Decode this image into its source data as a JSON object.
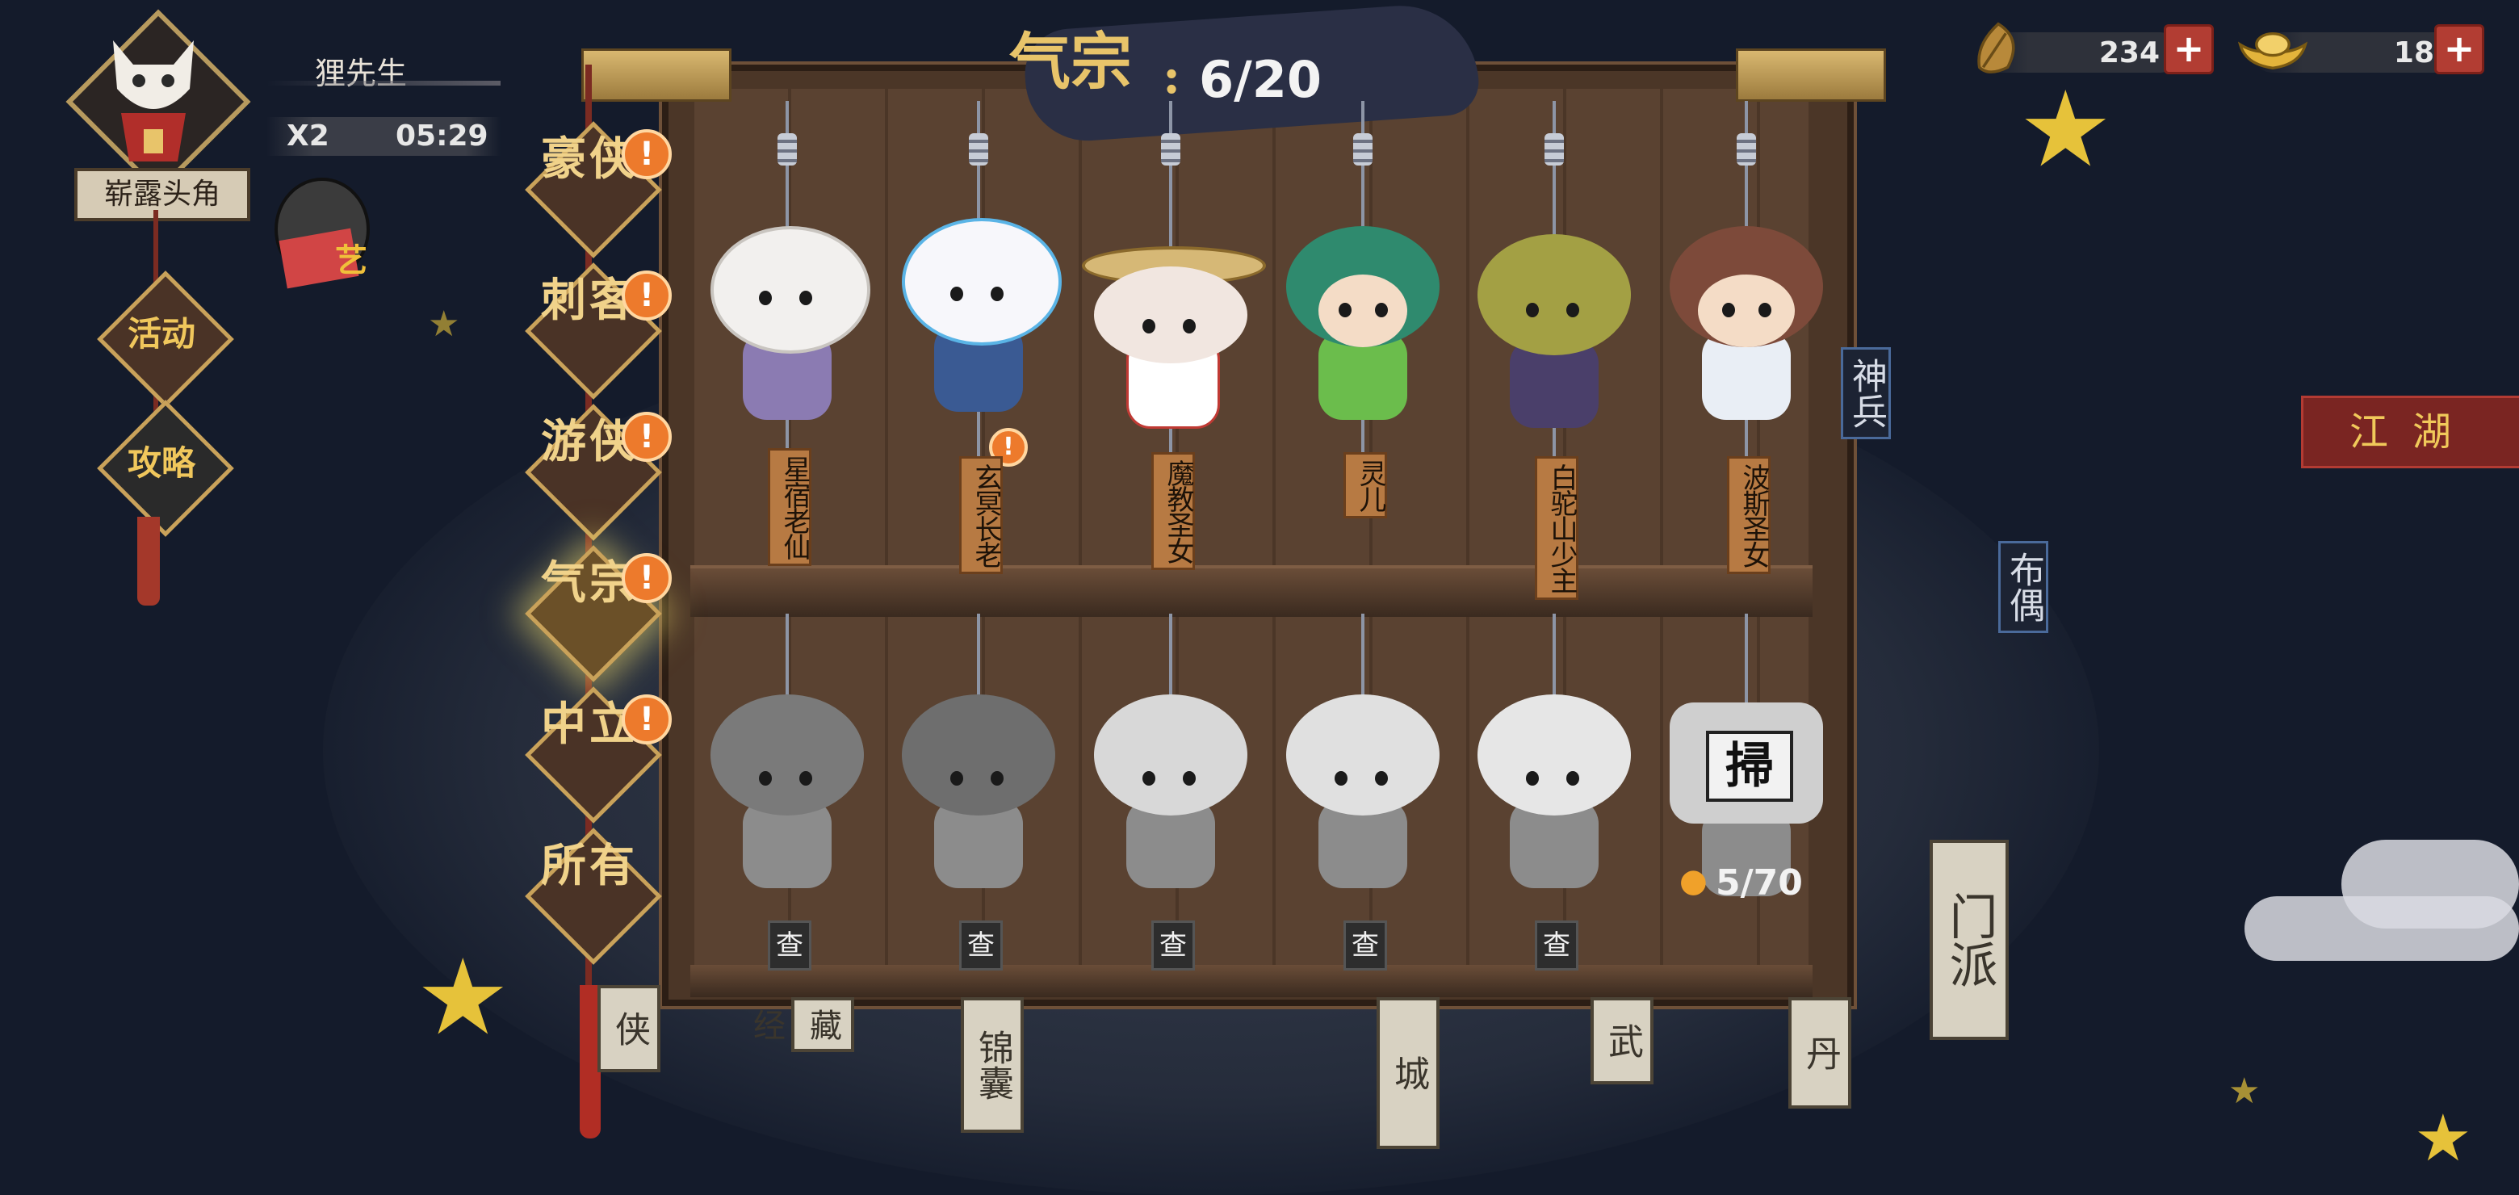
{
  "player": {
    "name": "狸先生",
    "multiplier": "X2",
    "timer": "05:29",
    "title": "崭露头角"
  },
  "side_menu": [
    {
      "label": "活动"
    },
    {
      "label": "攻略"
    }
  ],
  "pet_label": "艺",
  "resources": [
    {
      "icon": "leaf-icon",
      "value": "234"
    },
    {
      "icon": "gold-ingot-icon",
      "value": "18"
    }
  ],
  "banner": {
    "sect": "气宗",
    "colon": ":",
    "count": "6/20"
  },
  "sect_tabs": [
    {
      "label": "豪侠",
      "alert": "!",
      "active": false
    },
    {
      "label": "刺客",
      "alert": "!",
      "active": false
    },
    {
      "label": "游侠",
      "alert": "!",
      "active": false
    },
    {
      "label": "气宗",
      "alert": "!",
      "active": true
    },
    {
      "label": "中立",
      "alert": "!",
      "active": false
    },
    {
      "label": "所有",
      "alert": "",
      "active": false
    }
  ],
  "dolls_top": [
    {
      "name": "星宿老仙",
      "head": "#f2f0ee",
      "body": "#8b7bb2"
    },
    {
      "name": "玄冥长老",
      "head": "#f7f7fb",
      "body": "#3a5a93",
      "alert": "!"
    },
    {
      "name": "魔教圣女",
      "head": "#f1e6e0",
      "body": "#ffffff"
    },
    {
      "name": "灵儿",
      "head": "#2f8a6e",
      "body": "#6bbd4c"
    },
    {
      "name": "白驼山少主",
      "head": "#a3a044",
      "body": "#4a3f6a"
    },
    {
      "name": "波斯圣女",
      "head": "#7d4a3a",
      "body": "#e9eef5"
    }
  ],
  "dolls_bottom": [
    {
      "label": "查"
    },
    {
      "label": "查"
    },
    {
      "label": "查"
    },
    {
      "label": "查"
    },
    {
      "label": "查"
    }
  ],
  "bottom_last": {
    "sign": "掃",
    "fragment": "5/70"
  },
  "right_tags": {
    "shenbing": "神兵",
    "buou": "布偶",
    "jianghu": "江湖",
    "menpai": "门派"
  },
  "bottom_hanging": [
    "侠",
    "锦囊",
    "藏经",
    "城",
    "武",
    "丹"
  ],
  "colors": {
    "gold": "#e8c46a",
    "alert": "#ed7a2c",
    "wood": "#4b3627"
  }
}
